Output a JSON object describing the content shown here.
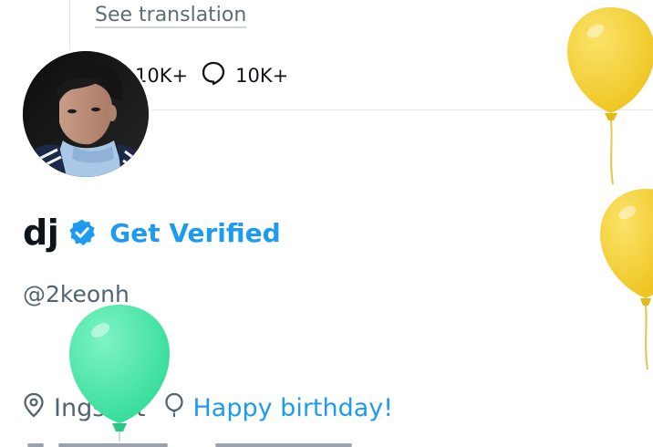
{
  "tweet_card": {
    "translation_label": "See translation",
    "reposts_count": "10K+",
    "replies_count": "10K+"
  },
  "profile": {
    "display_name": "dj",
    "get_verified_label": "Get Verified",
    "handle": "@2keonh",
    "location": "Ingshot",
    "bio_link": "Happy birthday!"
  },
  "colors": {
    "accent": "#1d9bf0",
    "text_primary": "#0f1419",
    "text_secondary": "#536471",
    "balloon_yellow": "#f5cf2a",
    "balloon_green": "#3de0a0"
  },
  "icons": {
    "verified": "verified-badge-icon",
    "reply": "reply-bubble-icon",
    "location": "location-pin-icon",
    "birthday": "balloon-icon"
  }
}
